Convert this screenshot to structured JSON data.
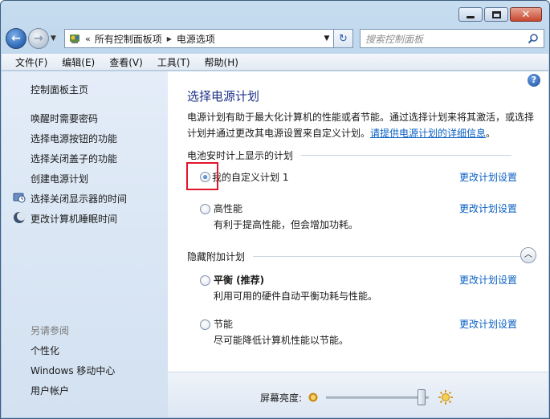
{
  "window": {
    "minimize_label": "",
    "maximize_label": "",
    "close_glyph": "✕"
  },
  "nav": {
    "back_glyph": "←",
    "forward_glyph": "→",
    "history_glyph": "▼",
    "address": {
      "chevron": "«",
      "segments": [
        "所有控制面板项",
        "电源选项"
      ],
      "sep_glyph": "▶",
      "drop_glyph": "▼"
    },
    "refresh_glyph": "↻",
    "search_placeholder": "搜索控制面板"
  },
  "menu": [
    "文件(F)",
    "编辑(E)",
    "查看(V)",
    "工具(T)",
    "帮助(H)"
  ],
  "sidebar": {
    "home": "控制面板主页",
    "links": [
      "唤醒时需要密码",
      "选择电源按钮的功能",
      "选择关闭盖子的功能",
      "创建电源计划",
      "选择关闭显示器的时间",
      "更改计算机睡眠时间"
    ],
    "see_also_heading": "另请参阅",
    "see_also": [
      "个性化",
      "Windows 移动中心",
      "用户帐户"
    ]
  },
  "main": {
    "help_glyph": "?",
    "title": "选择电源计划",
    "desc_text": "电源计划有助于最大化计算机的性能或者节能。通过选择计划来将其激活，或选择计划并通过更改其电源设置来自定义计划。",
    "desc_link": "请提供电源计划的详细信息",
    "desc_end": "。",
    "battery_group": "电池安时计上显示的计划",
    "hidden_group": "隐藏附加计划",
    "collapse_glyph": "︿",
    "change_link": "更改计划设置",
    "plans": [
      {
        "name": "我的自定义计划 1",
        "desc": "",
        "selected": true
      },
      {
        "name": "高性能",
        "desc": "有利于提高性能，但会增加功耗。",
        "selected": false
      },
      {
        "name": "平衡 (推荐)",
        "desc": "利用可用的硬件自动平衡功耗与性能。",
        "selected": false
      },
      {
        "name": "节能",
        "desc": "尽可能降低计算机性能以节能。",
        "selected": false
      }
    ],
    "brightness_label": "屏幕亮度:",
    "brightness_level": 0.97
  },
  "colors": {
    "title_blue": "#1e3287",
    "link_blue": "#0b61c4",
    "highlight_red": "#e0172b"
  }
}
